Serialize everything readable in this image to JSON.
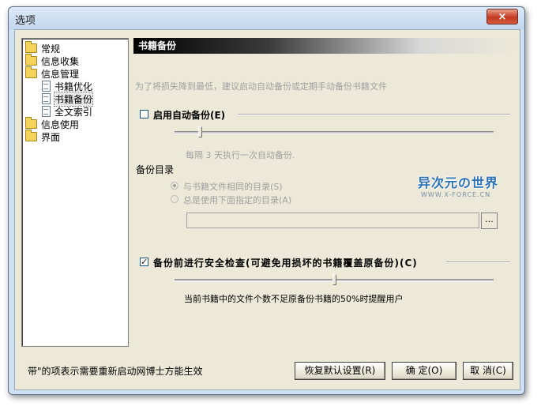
{
  "window": {
    "title": "选项",
    "close_symbol": "×"
  },
  "tree": {
    "items": [
      {
        "label": "常规",
        "icon": "folder-icon",
        "level": 0
      },
      {
        "label": "信息收集",
        "icon": "folder-icon",
        "level": 0
      },
      {
        "label": "信息管理",
        "icon": "folder-icon",
        "level": 0
      },
      {
        "label": "书籍优化",
        "icon": "doc-icon",
        "level": 1
      },
      {
        "label": "书籍备份",
        "icon": "doc-icon",
        "level": 1,
        "selected": true
      },
      {
        "label": "全文索引",
        "icon": "doc-icon",
        "level": 1
      },
      {
        "label": "信息使用",
        "icon": "folder-icon",
        "level": 0
      },
      {
        "label": "界面",
        "icon": "folder-icon",
        "level": 0
      }
    ]
  },
  "panel": {
    "header": "书籍备份",
    "description": "为了将损失降到最低，建议启动自动备份或定期手动备份书籍文件",
    "auto_backup": {
      "label": "启用自动备份(E)",
      "checked": false
    },
    "interval_text": "每隔 3 天执行一次自动备份.",
    "backup_dir_label": "备份目录",
    "radio_same": "与书籍文件相同的目录(S)",
    "radio_custom": "总是使用下面指定的目录(A)",
    "dir_path_value": "",
    "browse_label": "...",
    "safety_check": {
      "label": "备份前进行安全检查(可避免用损坏的书籍覆盖原备份)(C)",
      "checked": true,
      "check_symbol": "✓"
    },
    "threshold_text": "当前书籍中的文件个数不足原备份书籍的50%时提醒用户"
  },
  "watermark": {
    "main": "异次元の世界",
    "sub": "WWW.X-FORCE.CN"
  },
  "footer": {
    "note": "带\"的项表示需要重新启动网博士方能生效",
    "restore_label": "恢复默认设置(R)",
    "ok_label": "确 定(O)",
    "cancel_label": "取 消(C)"
  }
}
